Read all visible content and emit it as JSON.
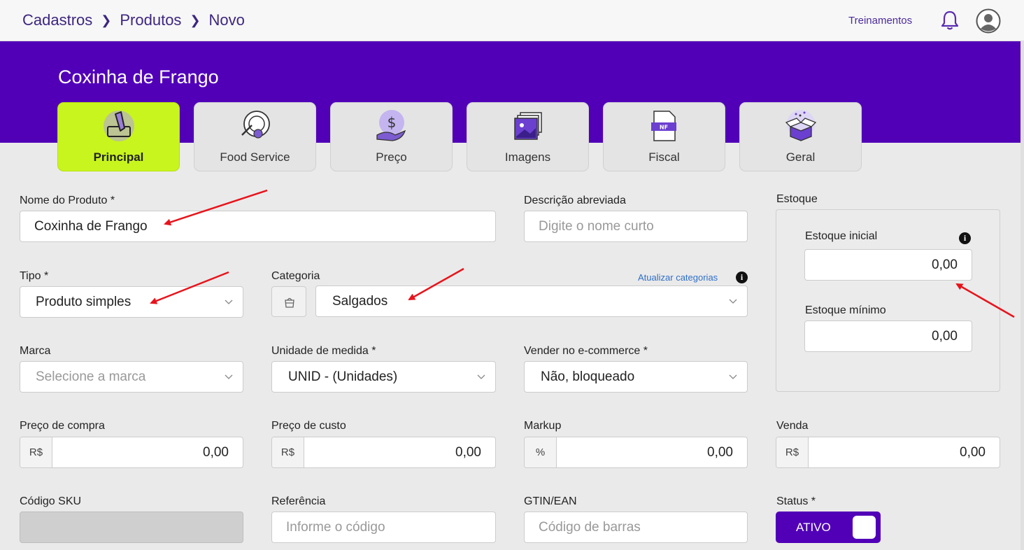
{
  "breadcrumb": [
    "Cadastros",
    "Produtos",
    "Novo"
  ],
  "header": {
    "trainings": "Treinamentos",
    "bell_icon": "bell-icon",
    "avatar_icon": "user-avatar-icon"
  },
  "product_title": "Coxinha de Frango",
  "tabs": [
    {
      "label": "Principal",
      "icon": "pencil-box-icon",
      "active": true
    },
    {
      "label": "Food Service",
      "icon": "plate-cutlery-icon"
    },
    {
      "label": "Preço",
      "icon": "money-hand-icon"
    },
    {
      "label": "Imagens",
      "icon": "images-icon"
    },
    {
      "label": "Fiscal",
      "icon": "nf-document-icon"
    },
    {
      "label": "Geral",
      "icon": "open-box-icon"
    }
  ],
  "form": {
    "nome_label": "Nome do Produto *",
    "nome_value": "Coxinha de Frango",
    "descricao_label": "Descrição abreviada",
    "descricao_placeholder": "Digite o nome curto",
    "tipo_label": "Tipo *",
    "tipo_value": "Produto simples",
    "categoria_label": "Categoria",
    "atualizar_categorias": "Atualizar categorias",
    "categoria_value": "Salgados",
    "marca_label": "Marca",
    "marca_placeholder": "Selecione a marca",
    "unidade_label": "Unidade de medida *",
    "unidade_value": "UNID - (Unidades)",
    "ecommerce_label": "Vender no e-commerce *",
    "ecommerce_value": "Não, bloqueado",
    "preco_compra_label": "Preço de compra",
    "preco_custo_label": "Preço de custo",
    "markup_label": "Markup",
    "venda_label": "Venda",
    "currency": "R$",
    "percent": "%",
    "preco_compra_value": "0,00",
    "preco_custo_value": "0,00",
    "markup_value": "0,00",
    "venda_value": "0,00",
    "sku_label": "Código SKU",
    "referencia_label": "Referência",
    "referencia_placeholder": "Informe o código",
    "gtin_label": "GTIN/EAN",
    "gtin_placeholder": "Código de barras",
    "status_label": "Status *",
    "status_value": "ATIVO"
  },
  "estoque": {
    "title": "Estoque",
    "inicial_label": "Estoque inicial",
    "inicial_value": "0,00",
    "minimo_label": "Estoque mínimo",
    "minimo_value": "0,00"
  },
  "info_glyph": "i",
  "colors": {
    "brand": "#5100b8",
    "active_tab": "#c8f51e",
    "annotation": "#e8131b"
  }
}
